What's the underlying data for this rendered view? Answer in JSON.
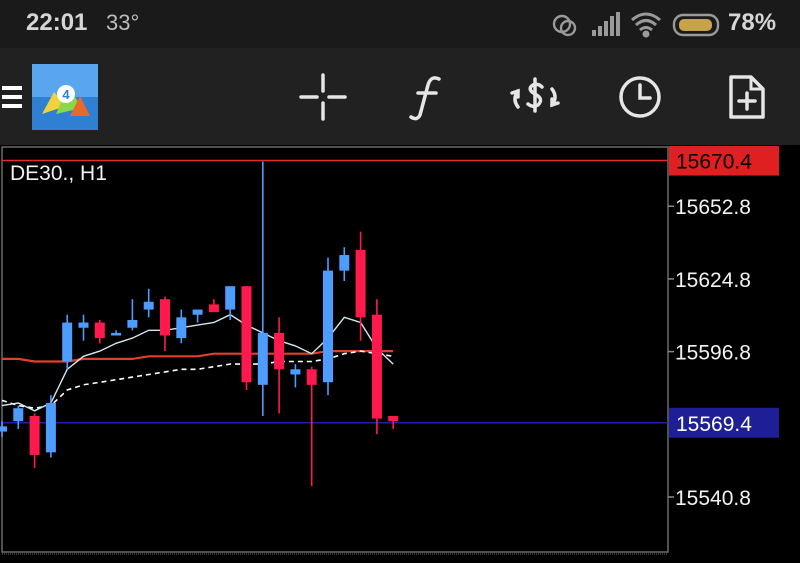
{
  "status_bar": {
    "time": "22:01",
    "temperature": "33°",
    "battery_percent": "78%",
    "icons": [
      "hotspot-icon",
      "signal-icon",
      "wifi-icon",
      "battery-icon"
    ]
  },
  "toolbar": {
    "buttons": [
      {
        "name": "menu-icon"
      },
      {
        "name": "app-logo-icon"
      },
      {
        "name": "crosshair-icon"
      },
      {
        "name": "indicators-f-icon"
      },
      {
        "name": "symbols-dollar-icon"
      },
      {
        "name": "timeframe-clock-icon"
      },
      {
        "name": "new-order-icon"
      }
    ]
  },
  "colors": {
    "bull": "#4d9cff",
    "bear": "#ff1a4d",
    "ma_fast": "#cfe8f2",
    "ma_slow": "#ffffff",
    "ma_long": "#e0402a",
    "ask_line": "#e82a2a",
    "bid_line": "#2020a8",
    "ask_tag": "#e02020",
    "bid_tag": "#1e1e96"
  },
  "chart_data": {
    "type": "candlestick",
    "title": "DE30., H1",
    "symbol": "DE30.",
    "timeframe": "H1",
    "ylim": [
      15520,
      15676
    ],
    "y_ticks": [
      "15652.8",
      "15624.8",
      "15596.8",
      "15540.8"
    ],
    "y_tick_values": [
      15652.8,
      15624.8,
      15596.8,
      15540.8
    ],
    "ask_price": "15670.4",
    "ask_value": 15670.4,
    "bid_price": "15569.4",
    "bid_value": 15569.4,
    "grid": false,
    "candles": [
      {
        "o": 15566,
        "h": 15570,
        "l": 15564,
        "c": 15568
      },
      {
        "o": 15570,
        "h": 15576,
        "l": 15567,
        "c": 15575
      },
      {
        "o": 15572,
        "h": 15573,
        "l": 15552,
        "c": 15557
      },
      {
        "o": 15558,
        "h": 15580,
        "l": 15556,
        "c": 15577
      },
      {
        "o": 15593,
        "h": 15611,
        "l": 15590,
        "c": 15608
      },
      {
        "o": 15606,
        "h": 15611,
        "l": 15601,
        "c": 15608
      },
      {
        "o": 15608,
        "h": 15609,
        "l": 15600,
        "c": 15602
      },
      {
        "o": 15603,
        "h": 15605,
        "l": 15603,
        "c": 15604
      },
      {
        "o": 15606,
        "h": 15617,
        "l": 15605,
        "c": 15609
      },
      {
        "o": 15613,
        "h": 15621,
        "l": 15610,
        "c": 15616
      },
      {
        "o": 15617,
        "h": 15618,
        "l": 15597,
        "c": 15603
      },
      {
        "o": 15602,
        "h": 15613,
        "l": 15600,
        "c": 15610
      },
      {
        "o": 15611,
        "h": 15612,
        "l": 15608,
        "c": 15613
      },
      {
        "o": 15615,
        "h": 15617,
        "l": 15612,
        "c": 15612
      },
      {
        "o": 15613,
        "h": 15620,
        "l": 15609,
        "c": 15622
      },
      {
        "o": 15622,
        "h": 15622,
        "l": 15582,
        "c": 15585
      },
      {
        "o": 15584,
        "h": 15670,
        "l": 15572,
        "c": 15604
      },
      {
        "o": 15604,
        "h": 15610,
        "l": 15573,
        "c": 15590
      },
      {
        "o": 15588,
        "h": 15592,
        "l": 15583,
        "c": 15590
      },
      {
        "o": 15590,
        "h": 15591,
        "l": 15545,
        "c": 15584
      },
      {
        "o": 15585,
        "h": 15633,
        "l": 15580,
        "c": 15628
      },
      {
        "o": 15628,
        "h": 15637,
        "l": 15624,
        "c": 15634
      },
      {
        "o": 15636,
        "h": 15643,
        "l": 15601,
        "c": 15610
      },
      {
        "o": 15611,
        "h": 15617,
        "l": 15565,
        "c": 15571
      },
      {
        "o": 15572,
        "h": 15572,
        "l": 15567,
        "c": 15570
      }
    ],
    "ma_fast": [
      15576,
      15577,
      15574,
      15577,
      15590,
      15595,
      15597,
      15600,
      15602,
      15605,
      15605,
      15606,
      15607,
      15608,
      15611,
      15607,
      15604,
      15601,
      15599,
      15596,
      15602,
      15610,
      15608,
      15598,
      15592
    ],
    "ma_slow": [
      15578,
      15576,
      15575,
      15576,
      15582,
      15584,
      15585,
      15586,
      15587,
      15588,
      15589,
      15590,
      15590,
      15591,
      15592,
      15592,
      15592,
      15593,
      15593,
      15593,
      15594,
      15596,
      15597,
      15596,
      15595
    ],
    "ma_long": [
      15594,
      15594,
      15593,
      15593,
      15593,
      15594,
      15594,
      15594,
      15594,
      15595,
      15595,
      15595,
      15595,
      15596,
      15596,
      15596,
      15596,
      15596,
      15596,
      15596,
      15597,
      15597,
      15597,
      15597,
      15597
    ]
  }
}
